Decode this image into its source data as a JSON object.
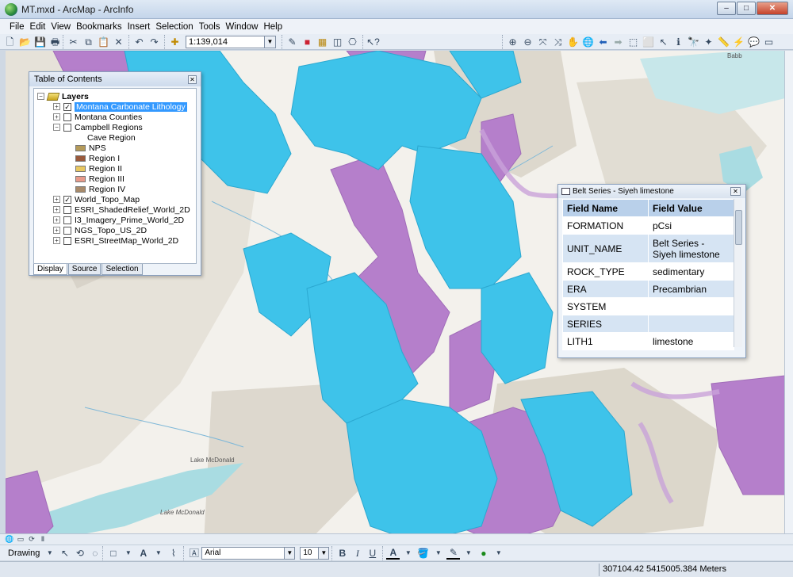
{
  "window": {
    "title": "MT.mxd - ArcMap - ArcInfo",
    "minimize": "–",
    "maximize": "□",
    "close": "✕"
  },
  "menu": [
    "File",
    "Edit",
    "View",
    "Bookmarks",
    "Insert",
    "Selection",
    "Tools",
    "Window",
    "Help"
  ],
  "toolbar": {
    "scale": "1:139,014"
  },
  "toc": {
    "title": "Table of Contents",
    "root": "Layers",
    "layers": [
      {
        "name": "Montana Carbonate Lithology",
        "checked": true,
        "expanded": false,
        "selected": true
      },
      {
        "name": "Montana Counties",
        "checked": false,
        "expanded": false
      },
      {
        "name": "Campbell Regions",
        "checked": false,
        "expanded": true
      },
      {
        "name": "World_Topo_Map",
        "checked": true,
        "expanded": false
      },
      {
        "name": "ESRI_ShadedRelief_World_2D",
        "checked": false,
        "expanded": false
      },
      {
        "name": "I3_Imagery_Prime_World_2D",
        "checked": false,
        "expanded": false
      },
      {
        "name": "NGS_Topo_US_2D",
        "checked": false,
        "expanded": false
      },
      {
        "name": "ESRI_StreetMap_World_2D",
        "checked": false,
        "expanded": false
      }
    ],
    "legend_heading": "Cave Region",
    "legend": [
      {
        "label": "NPS",
        "color": "#b49a5a"
      },
      {
        "label": "Region I",
        "color": "#9a5a3c"
      },
      {
        "label": "Region II",
        "color": "#e8c760"
      },
      {
        "label": "Region III",
        "color": "#e89a8a"
      },
      {
        "label": "Region IV",
        "color": "#a88a6a"
      }
    ],
    "tabs": [
      "Display",
      "Source",
      "Selection"
    ]
  },
  "identify": {
    "title": "Belt Series - Siyeh limestone",
    "headers": [
      "Field Name",
      "Field Value"
    ],
    "rows": [
      {
        "field": "FORMATION",
        "value": "pCsi"
      },
      {
        "field": "UNIT_NAME",
        "value": "Belt Series - Siyeh limestone"
      },
      {
        "field": "ROCK_TYPE",
        "value": "sedimentary"
      },
      {
        "field": "ERA",
        "value": "Precambrian"
      },
      {
        "field": "SYSTEM",
        "value": ""
      },
      {
        "field": "SERIES",
        "value": ""
      },
      {
        "field": "LITH1",
        "value": "limestone"
      }
    ]
  },
  "map_labels": [
    "Lake McDonald",
    "Lake McDonald",
    "Babb"
  ],
  "colors": {
    "limestone": "#3ec3ea",
    "other_carbonate": "#b57fcb",
    "water": "#a9dce2"
  },
  "drawing": {
    "label": "Drawing",
    "font": "Arial",
    "size": "10"
  },
  "status": {
    "coordinates": "307104.42  5415005.384 Meters"
  }
}
